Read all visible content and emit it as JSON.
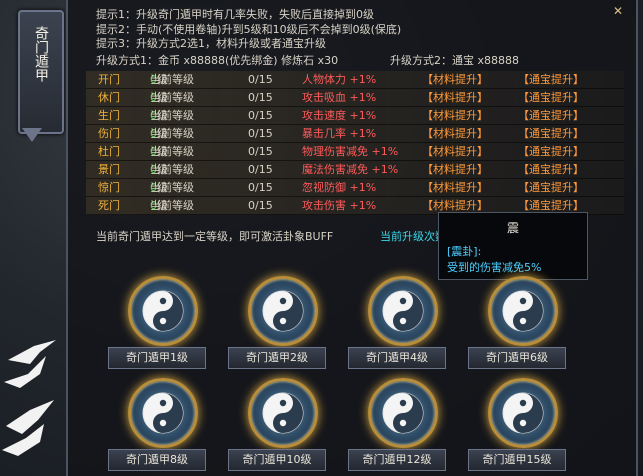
{
  "side_title": "奇门遁甲",
  "tips": [
    "提示1：升级奇门遁甲时有几率失败，失败后直接掉到0级",
    "提示2：手动(不使用卷轴)升到5级和10级后不会掉到0级(保底)",
    "提示3：升级方式2选1，材料升级或者通宝升级"
  ],
  "methods": {
    "m1_label": "升级方式1：金币 x88888(优先绑金)  修炼石 x30",
    "m2_label": "升级方式2：通宝 x88888"
  },
  "gates": [
    {
      "name": "开门",
      "level_prefix": "当前等级",
      "level": "0",
      "level_suffix": "级",
      "progress": "0/15",
      "attr": "人物体力 +1%",
      "btn1": "【材料提升】",
      "btn2": "【通宝提升】"
    },
    {
      "name": "休门",
      "level_prefix": "当前等级",
      "level": "0",
      "level_suffix": "级",
      "progress": "0/15",
      "attr": "攻击吸血 +1%",
      "btn1": "【材料提升】",
      "btn2": "【通宝提升】"
    },
    {
      "name": "生门",
      "level_prefix": "当前等级",
      "level": "0",
      "level_suffix": "级",
      "progress": "0/15",
      "attr": "攻击速度 +1%",
      "btn1": "【材料提升】",
      "btn2": "【通宝提升】"
    },
    {
      "name": "伤门",
      "level_prefix": "当前等级",
      "level": "0",
      "level_suffix": "级",
      "progress": "0/15",
      "attr": "暴击几率 +1%",
      "btn1": "【材料提升】",
      "btn2": "【通宝提升】"
    },
    {
      "name": "杜门",
      "level_prefix": "当前等级",
      "level": "0",
      "level_suffix": "级",
      "progress": "0/15",
      "attr": "物理伤害减免 +1%",
      "btn1": "【材料提升】",
      "btn2": "【通宝提升】"
    },
    {
      "name": "景门",
      "level_prefix": "当前等级",
      "level": "0",
      "level_suffix": "级",
      "progress": "0/15",
      "attr": "魔法伤害减免 +1%",
      "btn1": "【材料提升】",
      "btn2": "【通宝提升】"
    },
    {
      "name": "惊门",
      "level_prefix": "当前等级",
      "level": "0",
      "level_suffix": "级",
      "progress": "0/15",
      "attr": "忽视防御 +1%",
      "btn1": "【材料提升】",
      "btn2": "【通宝提升】"
    },
    {
      "name": "死门",
      "level_prefix": "当前等级",
      "level": "0",
      "level_suffix": "级",
      "progress": "0/15",
      "attr": "攻击伤害 +1%",
      "btn1": "【材料提升】",
      "btn2": "【通宝提升】"
    }
  ],
  "buff_text": "当前奇门遁甲达到一定等级，即可激活卦象BUFF",
  "current_level_text": "当前升级次数：0次",
  "tooltip": {
    "title": "震",
    "line1": "[震卦]:",
    "line2": "受到的伤害减免5%"
  },
  "activations": [
    "奇门遁甲1级",
    "奇门遁甲2级",
    "奇门遁甲4级",
    "奇门遁甲6级",
    "奇门遁甲8级",
    "奇门遁甲10级",
    "奇门遁甲12级",
    "奇门遁甲15级"
  ],
  "colors": {
    "gate_name": "#f0b23c",
    "level_value": "#58e04c",
    "attribute": "#ff5a5a",
    "action_button": "#ff9a3c",
    "tooltip_text": "#4fd0ff"
  },
  "icons": {
    "close": "close-icon",
    "yinyang": "yinyang-icon",
    "crane": "crane-icon"
  }
}
